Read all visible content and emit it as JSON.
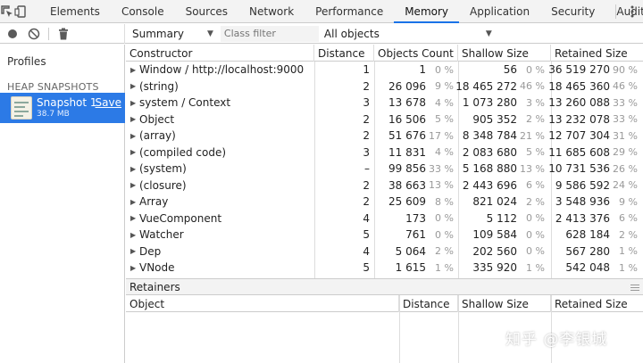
{
  "tabs": [
    "Elements",
    "Console",
    "Sources",
    "Network",
    "Performance",
    "Memory",
    "Application",
    "Security",
    "Audits"
  ],
  "active_tab": "Memory",
  "toolbar": {
    "view_select": "Summary",
    "class_filter_placeholder": "Class filter",
    "objects_select": "All objects"
  },
  "sidebar": {
    "profiles_label": "Profiles",
    "heap_snapshots_label": "HEAP SNAPSHOTS",
    "snapshot": {
      "title": "Snapshot 1",
      "size": "38.7 MB",
      "save_label": "Save"
    }
  },
  "table": {
    "columns": [
      "Constructor",
      "Distance",
      "Objects Count",
      "Shallow Size",
      "Retained Size"
    ],
    "rows": [
      {
        "name": "Window / http://localhost:9000",
        "distance": "1",
        "objects": "1",
        "objects_pct": "0 %",
        "shallow": "56",
        "shallow_pct": "0 %",
        "retained": "36 519 270",
        "retained_pct": "90 %"
      },
      {
        "name": "(string)",
        "distance": "2",
        "objects": "26 096",
        "objects_pct": "9 %",
        "shallow": "18 465 272",
        "shallow_pct": "46 %",
        "retained": "18 465 360",
        "retained_pct": "46 %"
      },
      {
        "name": "system / Context",
        "distance": "3",
        "objects": "13 678",
        "objects_pct": "4 %",
        "shallow": "1 073 280",
        "shallow_pct": "3 %",
        "retained": "13 260 088",
        "retained_pct": "33 %"
      },
      {
        "name": "Object",
        "distance": "2",
        "objects": "16 506",
        "objects_pct": "5 %",
        "shallow": "905 352",
        "shallow_pct": "2 %",
        "retained": "13 232 078",
        "retained_pct": "33 %"
      },
      {
        "name": "(array)",
        "distance": "2",
        "objects": "51 676",
        "objects_pct": "17 %",
        "shallow": "8 348 784",
        "shallow_pct": "21 %",
        "retained": "12 707 304",
        "retained_pct": "31 %"
      },
      {
        "name": "(compiled code)",
        "distance": "3",
        "objects": "11 831",
        "objects_pct": "4 %",
        "shallow": "2 083 680",
        "shallow_pct": "5 %",
        "retained": "11 685 608",
        "retained_pct": "29 %"
      },
      {
        "name": "(system)",
        "distance": "–",
        "objects": "99 856",
        "objects_pct": "33 %",
        "shallow": "5 168 880",
        "shallow_pct": "13 %",
        "retained": "10 731 536",
        "retained_pct": "26 %"
      },
      {
        "name": "(closure)",
        "distance": "2",
        "objects": "38 663",
        "objects_pct": "13 %",
        "shallow": "2 443 696",
        "shallow_pct": "6 %",
        "retained": "9 586 592",
        "retained_pct": "24 %"
      },
      {
        "name": "Array",
        "distance": "2",
        "objects": "25 609",
        "objects_pct": "8 %",
        "shallow": "821 024",
        "shallow_pct": "2 %",
        "retained": "3 548 936",
        "retained_pct": "9 %"
      },
      {
        "name": "VueComponent",
        "distance": "4",
        "objects": "173",
        "objects_pct": "0 %",
        "shallow": "5 112",
        "shallow_pct": "0 %",
        "retained": "2 413 376",
        "retained_pct": "6 %"
      },
      {
        "name": "Watcher",
        "distance": "5",
        "objects": "761",
        "objects_pct": "0 %",
        "shallow": "109 584",
        "shallow_pct": "0 %",
        "retained": "628 184",
        "retained_pct": "2 %"
      },
      {
        "name": "Dep",
        "distance": "4",
        "objects": "5 064",
        "objects_pct": "2 %",
        "shallow": "202 560",
        "shallow_pct": "0 %",
        "retained": "567 280",
        "retained_pct": "1 %"
      },
      {
        "name": "VNode",
        "distance": "5",
        "objects": "1 615",
        "objects_pct": "1 %",
        "shallow": "335 920",
        "shallow_pct": "1 %",
        "retained": "542 048",
        "retained_pct": "1 %"
      }
    ]
  },
  "retainers": {
    "title": "Retainers",
    "columns": [
      "Object",
      "Distance",
      "Shallow Size",
      "Retained Size"
    ]
  },
  "watermark": "知乎 @李银城",
  "colors": {
    "accent": "#1a73e8",
    "selection": "#2c7ae6"
  }
}
